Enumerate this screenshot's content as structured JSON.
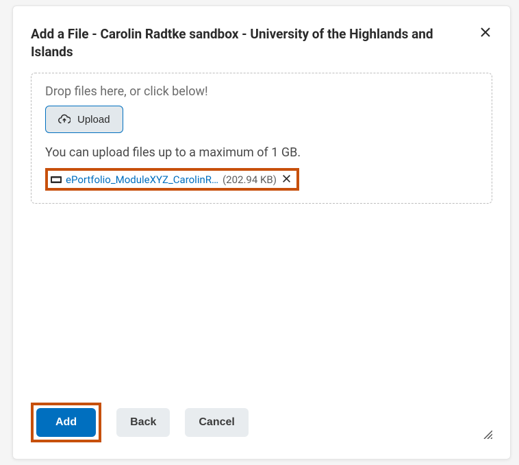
{
  "dialog": {
    "title": "Add a File - Carolin Radtke sandbox - University of the Highlands and Islands"
  },
  "dropzone": {
    "promptText": "Drop files here, or click below!",
    "uploadLabel": "Upload",
    "limitText": "You can upload files up to a maximum of 1 GB."
  },
  "uploadedFile": {
    "name": "ePortfolio_ModuleXYZ_CarolinR…",
    "size": "(202.94 KB)"
  },
  "footer": {
    "addLabel": "Add",
    "backLabel": "Back",
    "cancelLabel": "Cancel"
  }
}
